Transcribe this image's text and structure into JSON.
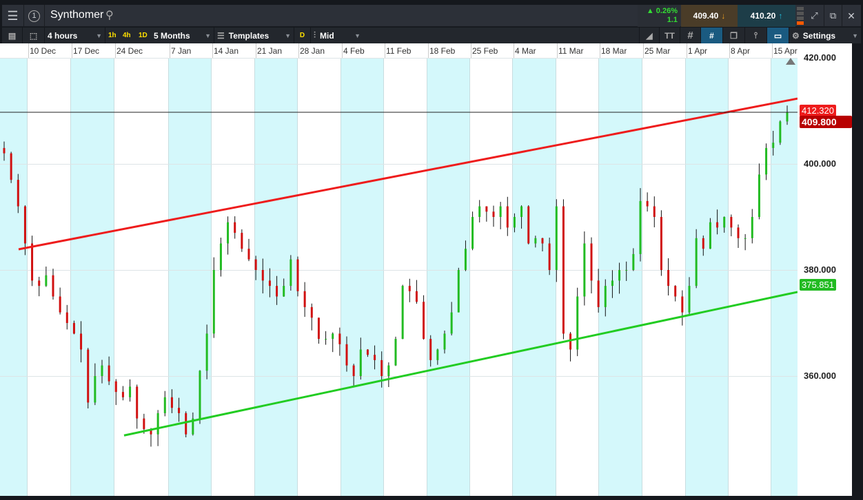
{
  "header": {
    "instrument": "Synthomer",
    "window_number": "1",
    "change_pct": "0.26%",
    "change_abs": "1.1",
    "sell_price": "409.40",
    "buy_price": "410.20"
  },
  "toolbar": {
    "interval": "4 hours",
    "quick_1h": "1h",
    "quick_4h": "4h",
    "quick_1d": "1D",
    "range": "5 Months",
    "templates": "Templates",
    "d_label": "D",
    "price_type": "Mid",
    "settings": "Settings",
    "text_tool": "TT"
  },
  "x_axis": {
    "dates": [
      "10 Dec",
      "17 Dec",
      "24 Dec",
      "7 Jan",
      "14 Jan",
      "21 Jan",
      "28 Jan",
      "4 Feb",
      "11 Feb",
      "18 Feb",
      "25 Feb",
      "4 Mar",
      "11 Mar",
      "18 Mar",
      "25 Mar",
      "1 Apr",
      "8 Apr",
      "15 Apr"
    ]
  },
  "y_axis": {
    "labels": [
      "420.000",
      "400.000",
      "380.000",
      "360.000"
    ]
  },
  "price_tags": {
    "upper_trend": "412.320",
    "current": "409.800",
    "lower_trend": "375.851"
  },
  "colors": {
    "up": "#22bb22",
    "down": "#d01010",
    "band": "#d4f8fb",
    "upper_line": "#ee1c1c",
    "lower_line": "#22cc22",
    "current_tag": "#b80000"
  },
  "chart_data": {
    "type": "candlestick",
    "title": "Synthomer",
    "ylim": [
      340,
      425
    ],
    "current_price": 409.8,
    "upper_trendline": {
      "start": 383.9,
      "end": 412.32
    },
    "lower_trendline": {
      "start": 348.8,
      "end": 375.851
    },
    "closes": [
      402,
      397,
      392,
      385,
      378,
      377,
      379,
      375,
      372,
      370,
      368,
      365,
      355,
      360,
      362,
      359,
      357,
      356,
      358,
      352,
      350,
      349,
      353,
      356,
      354,
      353,
      349,
      352,
      361,
      368,
      380,
      385,
      389,
      387,
      384,
      382,
      380,
      378,
      377,
      375,
      377,
      382,
      376,
      373,
      371,
      367,
      367,
      368,
      366,
      362,
      360,
      365,
      364,
      363,
      360,
      362,
      367,
      377,
      376,
      374,
      367,
      363,
      365,
      368,
      372,
      380,
      384,
      390,
      392,
      391,
      390,
      392,
      388,
      390,
      392,
      385,
      386,
      385,
      380,
      392,
      368,
      365,
      375,
      385,
      378,
      373,
      377,
      378,
      380,
      380,
      383,
      393,
      392,
      390,
      380,
      377,
      375,
      372,
      377,
      386,
      384,
      389,
      388,
      390,
      388,
      386,
      386,
      390,
      398,
      403,
      404,
      408,
      409.8
    ]
  }
}
